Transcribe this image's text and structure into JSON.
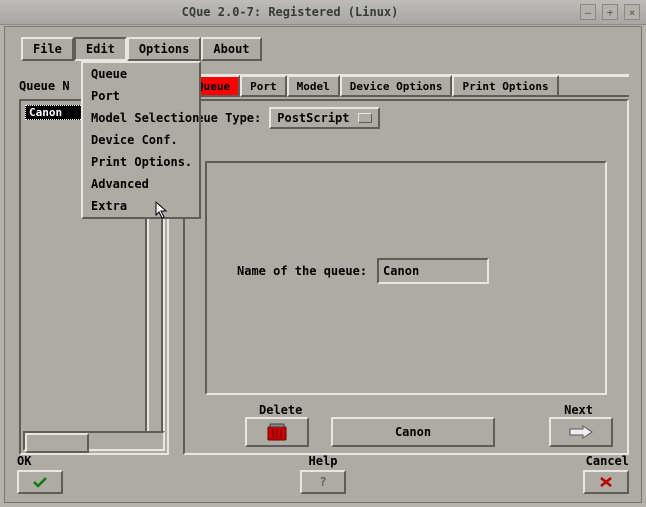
{
  "window": {
    "title": "CQue 2.0-7: Registered (Linux)"
  },
  "menubar": {
    "file": "File",
    "edit": "Edit",
    "options": "Options",
    "about": "About"
  },
  "edit_menu": {
    "queue": "Queue",
    "port": "Port",
    "model_selection": "Model Selection",
    "device_conf": "Device Conf.",
    "print_options": "Print Options.",
    "advanced": "Advanced",
    "extra": "Extra"
  },
  "sidebar": {
    "label_prefix": "Queue N",
    "items": [
      {
        "name": "Canon",
        "selected": true
      }
    ]
  },
  "tabs": {
    "queue": "Queue",
    "port": "Port",
    "model": "Model",
    "device_options": "Device Options",
    "print_options": "Print Options"
  },
  "queue_panel": {
    "type_label": "ueue Type:",
    "type_value": "PostScript",
    "name_label": "Name of the queue:",
    "name_value": "Canon",
    "delete_label": "Delete",
    "current_button": "Canon",
    "next_label": "Next"
  },
  "footer": {
    "ok": "OK",
    "help": "Help",
    "cancel": "Cancel"
  }
}
